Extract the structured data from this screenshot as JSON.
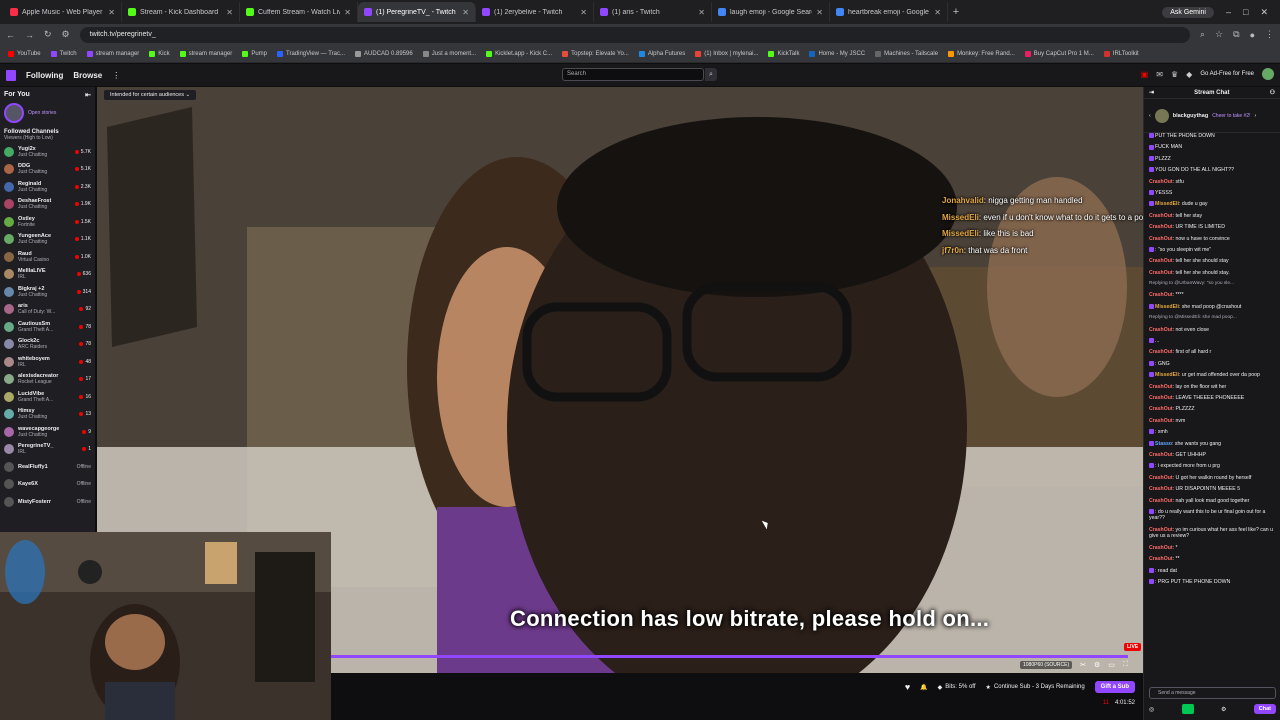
{
  "browser": {
    "tabs": [
      {
        "title": "Apple Music - Web Player",
        "color": "#fa2d48"
      },
      {
        "title": "Stream - Kick Dashboard",
        "color": "#53fc18"
      },
      {
        "title": "Cuffem Stream - Watch Live o",
        "color": "#53fc18"
      },
      {
        "title": "(1) PeregrineTV_ - Twitch",
        "color": "#9147ff",
        "active": true
      },
      {
        "title": "(1) 2erybelive - Twitch",
        "color": "#9147ff"
      },
      {
        "title": "(1) aris - Twitch",
        "color": "#9147ff"
      },
      {
        "title": "laugh emoji - Google Search",
        "color": "#4285f4"
      },
      {
        "title": "heartbreak emoji - Google Sea",
        "color": "#4285f4"
      }
    ],
    "ask_gemini": "Ask Gemini",
    "url": "twitch.tv/peregrinetv_",
    "bookmarks": [
      {
        "label": "YouTube",
        "color": "#ff0000"
      },
      {
        "label": "Twitch",
        "color": "#9147ff"
      },
      {
        "label": "stream manager",
        "color": "#9147ff"
      },
      {
        "label": "Kick",
        "color": "#53fc18"
      },
      {
        "label": "stream manager",
        "color": "#53fc18"
      },
      {
        "label": "Pump",
        "color": "#53fc18"
      },
      {
        "label": "TradingView — Trac...",
        "color": "#2962ff"
      },
      {
        "label": "AUDCAD 0.89596",
        "color": "#999999"
      },
      {
        "label": "Just a moment...",
        "color": "#888888"
      },
      {
        "label": "Kicklet.app - Kick C...",
        "color": "#53fc18"
      },
      {
        "label": "Topstep: Elevate Yo...",
        "color": "#e74c3c"
      },
      {
        "label": "Alpha Futures",
        "color": "#1e88e5"
      },
      {
        "label": "(1) Inbox | mylenai...",
        "color": "#ea4335"
      },
      {
        "label": "KickTalk",
        "color": "#53fc18"
      },
      {
        "label": "Home - My JSCC",
        "color": "#1565c0"
      },
      {
        "label": "Machines - Tailscale",
        "color": "#666666"
      },
      {
        "label": "Monkey: Free Rand...",
        "color": "#ff9800"
      },
      {
        "label": "Buy CapCut Pro 1 M...",
        "color": "#e91e63"
      },
      {
        "label": "IRLToolkit",
        "color": "#d32f2f"
      }
    ]
  },
  "twitch_nav": {
    "following": "Following",
    "browse": "Browse",
    "search_placeholder": "Search",
    "go_ad_free": "Go Ad-Free for Free"
  },
  "sidebar": {
    "for_you": "For You",
    "open_stories": "Open stories",
    "followed_title": "Followed Channels",
    "followed_sort": "Viewers (High to Low)",
    "channels": [
      {
        "name": "Yugi2x",
        "category": "Just Chatting",
        "viewers": "5.7K",
        "color": "#4a6",
        "live": true
      },
      {
        "name": "DDG",
        "category": "Just Chatting",
        "viewers": "5.1K",
        "color": "#a64",
        "live": true
      },
      {
        "name": "Reginald",
        "category": "Just Chatting",
        "viewers": "2.3K",
        "color": "#46a",
        "live": true
      },
      {
        "name": "DeshaeFrost",
        "category": "Just Chatting",
        "viewers": "1.9K",
        "color": "#a46",
        "live": true
      },
      {
        "name": "Ostley",
        "category": "Fortnite",
        "viewers": "1.5K",
        "color": "#6a4",
        "live": true
      },
      {
        "name": "YungeenAce",
        "category": "Just Chatting",
        "viewers": "1.1K",
        "color": "#6a6",
        "live": true
      },
      {
        "name": "Raud",
        "category": "Virtual Casino",
        "viewers": "1.0K",
        "color": "#864",
        "live": true
      },
      {
        "name": "MelllaLIVE",
        "category": "IRL",
        "viewers": "636",
        "color": "#a86",
        "live": true
      },
      {
        "name": "Bigkraj +2",
        "category": "Just Chatting",
        "viewers": "314",
        "color": "#68a",
        "live": true
      },
      {
        "name": "aris",
        "category": "Call of Duty: W...",
        "viewers": "92",
        "color": "#a68",
        "live": true
      },
      {
        "name": "CautiousSm",
        "category": "Grand Theft A...",
        "viewers": "78",
        "color": "#6a8",
        "live": true
      },
      {
        "name": "Glock2c",
        "category": "ARC Raiders",
        "viewers": "78",
        "color": "#88a",
        "live": true
      },
      {
        "name": "whiteboyem",
        "category": "IRL",
        "viewers": "48",
        "color": "#a88",
        "live": true
      },
      {
        "name": "alexisdacreator",
        "category": "Rocket League",
        "viewers": "17",
        "color": "#8a8",
        "live": true
      },
      {
        "name": "LucidVibe",
        "category": "Grand Theft A...",
        "viewers": "16",
        "color": "#aa6",
        "live": true
      },
      {
        "name": "Himsy",
        "category": "Just Chatting",
        "viewers": "13",
        "color": "#6aa",
        "live": true
      },
      {
        "name": "wavecapgeorge",
        "category": "Just Chatting",
        "viewers": "9",
        "color": "#a6a",
        "live": true
      },
      {
        "name": "PeregrineTV_",
        "category": "IRL",
        "viewers": "1",
        "color": "#98a",
        "live": true
      },
      {
        "name": "RealFluffy1",
        "category": "",
        "viewers": "Offline",
        "color": "#555",
        "live": false
      },
      {
        "name": "Kaye6X",
        "category": "",
        "viewers": "Offline",
        "color": "#555",
        "live": false
      },
      {
        "name": "MistyFosterr",
        "category": "",
        "viewers": "Offline",
        "color": "#555",
        "live": false
      }
    ]
  },
  "video": {
    "intended_label": "Intended for certain audiences",
    "overlay_chat": [
      {
        "user": "Jonahvalid",
        "text": ": nigga getting man handled"
      },
      {
        "user": "MissedEli",
        "text": ": even if u don't know what to do it gets to a point"
      },
      {
        "user": "MissedEli",
        "text": ": like this is bad"
      },
      {
        "user": "jf7r0n",
        "text": ": that was da front"
      }
    ],
    "buffer_message": "Connection has low bitrate, please hold on...",
    "live_label": "LIVE",
    "quality": "1080P60 (SOURCE)"
  },
  "infobar": {
    "bits": "Bits: 5% off",
    "continue_sub": "Continue Sub - 3 Days Remaining",
    "gift_sub": "Gift a Sub",
    "viewers": "11",
    "uptime": "4:01:52"
  },
  "chat": {
    "title": "Stream Chat",
    "pinned_user": "blackguythag",
    "pinned_text": "Cheer to take #2!",
    "messages": [
      {
        "user": "",
        "text": "PUT THE PHONE DOWN",
        "color": "#ff4f4f",
        "badge": true
      },
      {
        "user": "",
        "text": "FUCK MAN",
        "color": "#ff4f4f",
        "badge": true
      },
      {
        "user": "",
        "text": "PLZZZ",
        "color": "#ff4f4f",
        "badge": true
      },
      {
        "user": "",
        "text": "YOU GON DO THE ALL NIGHT??",
        "color": "#ff4f4f",
        "badge": true
      },
      {
        "user": "CrashOut",
        "text": ": stfu",
        "color": "#ff6b6b"
      },
      {
        "user": "",
        "text": "YESSS",
        "color": "#ff4f4f",
        "badge": true
      },
      {
        "user": "MissedEli",
        "text": ": dude u gay",
        "color": "#e3a73e",
        "badge": true
      },
      {
        "user": "CrashOut",
        "text": ": tell her stay",
        "color": "#ff6b6b"
      },
      {
        "user": "CrashOut",
        "text": ": UR TIME IS LIMITED",
        "color": "#ff6b6b"
      },
      {
        "user": "CrashOut",
        "text": ": now u have to convince",
        "color": "#ff6b6b"
      },
      {
        "user": "",
        "text": ": \"so you sleepin wit me\"",
        "color": "#ff4f4f",
        "badge": true
      },
      {
        "user": "CrashOut",
        "text": ": tell her she should stay",
        "color": "#ff6b6b"
      },
      {
        "user": "CrashOut",
        "text": ": tell her she should stay.",
        "color": "#ff6b6b"
      },
      {
        "user": "",
        "text": "Replying to @UrbanWavy: \"so you sle...",
        "color": "#adadb8",
        "reply": true
      },
      {
        "user": "CrashOut",
        "text": ": ****",
        "color": "#ff6b6b"
      },
      {
        "user": "MissedEli",
        "text": ": she mad poop @crashout",
        "color": "#e3a73e",
        "badge": true
      },
      {
        "user": "",
        "text": "Replying to @MissedEli: she mad poop...",
        "color": "#adadb8",
        "reply": true
      },
      {
        "user": "CrashOut",
        "text": ": not even close",
        "color": "#ff6b6b"
      },
      {
        "user": "",
        "text": "...",
        "color": "#ff4f4f",
        "badge": true
      },
      {
        "user": "CrashOut",
        "text": ": first of all hard r",
        "color": "#ff6b6b"
      },
      {
        "user": "",
        "text": ": GNG",
        "color": "#ff4f4f",
        "badge": true
      },
      {
        "user": "MissedEli",
        "text": ": ur get mad offended over da poop",
        "color": "#e3a73e",
        "badge": true
      },
      {
        "user": "CrashOut",
        "text": ": lay on the floor wit her",
        "color": "#ff6b6b"
      },
      {
        "user": "CrashOut",
        "text": ": LEAVE THEEEE PHONEEEE",
        "color": "#ff6b6b"
      },
      {
        "user": "CrashOut",
        "text": ": PLZZZZ",
        "color": "#ff6b6b"
      },
      {
        "user": "CrashOut",
        "text": ": nvm",
        "color": "#ff6b6b"
      },
      {
        "user": "",
        "text": ": smh",
        "color": "#ff4f4f",
        "badge": true
      },
      {
        "user": "Stasso",
        "text": ": she wants you gang",
        "color": "#5fa8ff",
        "badge": true
      },
      {
        "user": "CrashOut",
        "text": ": GET UHHHP",
        "color": "#ff6b6b"
      },
      {
        "user": "",
        "text": ": i expected more from u prg",
        "color": "#ff4f4f",
        "badge": true
      },
      {
        "user": "CrashOut",
        "text": ": U got her walkin round by herself",
        "color": "#ff6b6b"
      },
      {
        "user": "CrashOut",
        "text": ": UR DISAPOINTN MEEEE 5",
        "color": "#ff6b6b"
      },
      {
        "user": "CrashOut",
        "text": ": nah yall look mad good together",
        "color": "#ff6b6b"
      },
      {
        "user": "",
        "text": ": do u really want this to be ur final goin out for a year??",
        "color": "#ff4f4f",
        "badge": true
      },
      {
        "user": "CrashOut",
        "text": ": yo im curious what her ass feel like? can u give us a review?",
        "color": "#ff6b6b"
      },
      {
        "user": "CrashOut",
        "text": ": *",
        "color": "#ff6b6b"
      },
      {
        "user": "CrashOut",
        "text": ": **",
        "color": "#ff6b6b"
      },
      {
        "user": "",
        "text": ": read dat",
        "color": "#ff4f4f",
        "badge": true
      },
      {
        "user": "",
        "text": ": PRG PUT THE PHONE DOWN",
        "color": "#ff4f4f",
        "badge": true
      }
    ],
    "input_placeholder": "Send a message",
    "points": "0",
    "chat_button": "Chat"
  }
}
